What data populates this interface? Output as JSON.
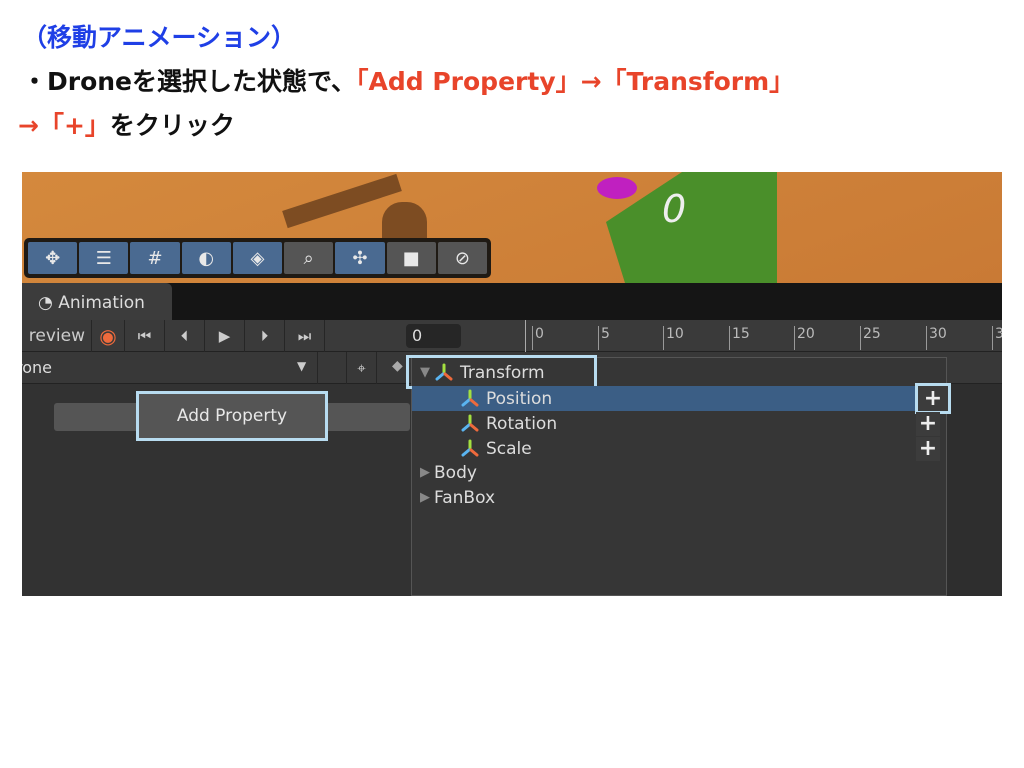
{
  "slide": {
    "line1": "（移動アニメーション）",
    "line2_prefix": "・Droneを選択した状態で、",
    "line2_red": "「Add Property」→「Transform」",
    "line3_red": "→「+」",
    "line3_suffix": "をクリック"
  },
  "colors": {
    "heading_blue": "#1f3fe6",
    "accent_red": "#e8442a",
    "highlight": "#b8dcf0",
    "selected_row": "#3b5e85"
  },
  "scene_toolbar": {
    "icons": [
      "move-tool-icon",
      "sliders-icon",
      "grid-snap-icon",
      "moon-icon",
      "layers-icon",
      "search-icon",
      "pivot-icon",
      "camera-view-icon",
      "compass-icon"
    ]
  },
  "animation": {
    "tab_label": "Animation",
    "preview_label": "review",
    "frame_value": "0",
    "ruler_ticks": [
      "0",
      "5",
      "10",
      "15",
      "20",
      "25",
      "30",
      "3"
    ],
    "clip_name": "rone",
    "add_property_label": "Add Property",
    "tree": [
      {
        "label": "Transform",
        "expanded": true,
        "children": [
          {
            "label": "Position",
            "selected": true
          },
          {
            "label": "Rotation"
          },
          {
            "label": "Scale"
          }
        ]
      },
      {
        "label": "Body",
        "expanded": false
      },
      {
        "label": "FanBox",
        "expanded": false
      }
    ],
    "plus_label": "+"
  }
}
